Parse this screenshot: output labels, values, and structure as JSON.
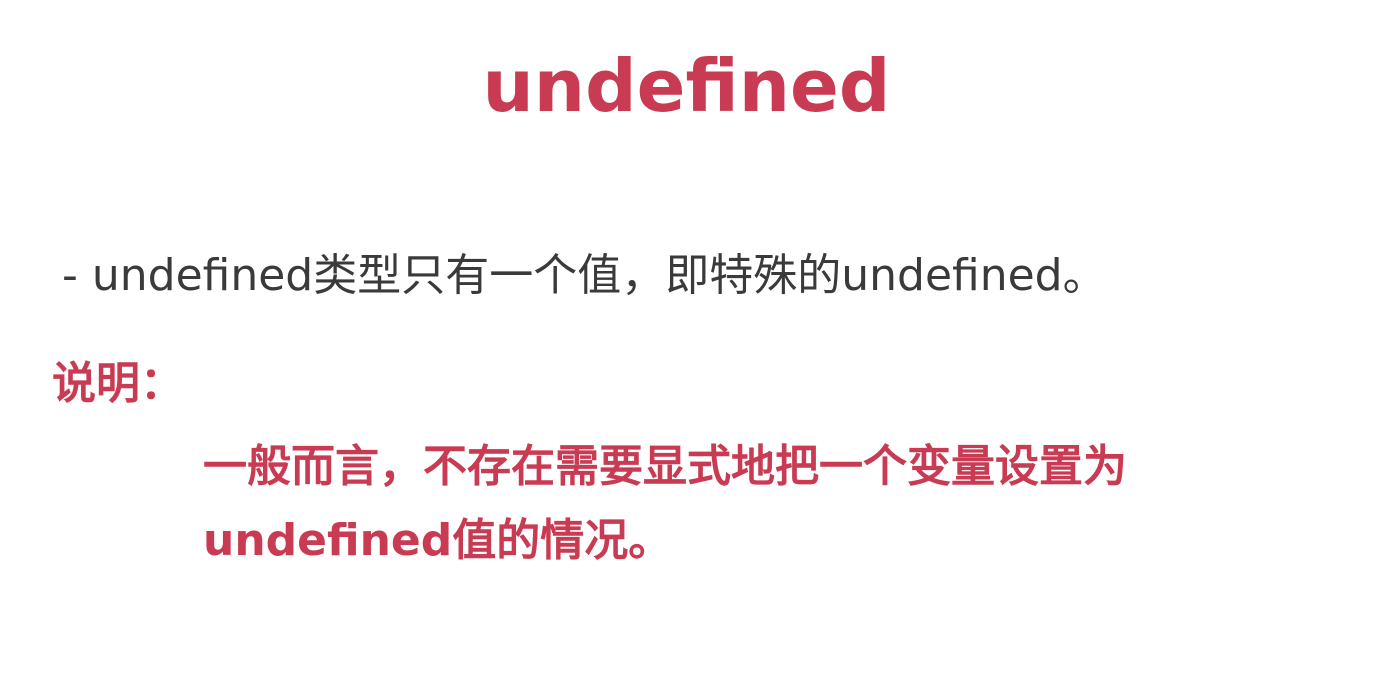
{
  "slide": {
    "title": "undefined",
    "bullet": "- undefined类型只有一个值，即特殊的undefined。",
    "note_label": "说明：",
    "note_lines": [
      "一般而言，不存在需要显式地把一个变量设置为",
      "undefined值的情况。"
    ]
  },
  "colors": {
    "accent": "#c93b52",
    "text": "#3a3a3a",
    "background": "#ffffff"
  }
}
